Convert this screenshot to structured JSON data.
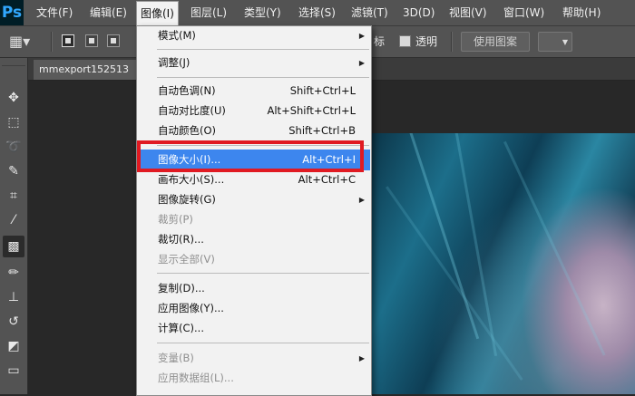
{
  "app": {
    "logo": "Ps"
  },
  "menubar": {
    "items": [
      "文件(F)",
      "编辑(E)",
      "图像(I)",
      "图层(L)",
      "类型(Y)",
      "选择(S)",
      "滤镜(T)",
      "3D(D)",
      "视图(V)",
      "窗口(W)",
      "帮助(H)"
    ],
    "active_index": 2
  },
  "options_bar": {
    "label_partial": "标",
    "transparent_label": "透明",
    "use_pattern_button": "使用图案"
  },
  "document": {
    "tab_title": "mmexport152513"
  },
  "image_menu": {
    "items": [
      {
        "label": "模式(M)",
        "shortcut": "",
        "submenu": true,
        "disabled": false
      },
      {
        "label": "调整(J)",
        "shortcut": "",
        "submenu": true,
        "disabled": false
      },
      {
        "label": "自动色调(N)",
        "shortcut": "Shift+Ctrl+L",
        "submenu": false,
        "disabled": false
      },
      {
        "label": "自动对比度(U)",
        "shortcut": "Alt+Shift+Ctrl+L",
        "submenu": false,
        "disabled": false
      },
      {
        "label": "自动颜色(O)",
        "shortcut": "Shift+Ctrl+B",
        "submenu": false,
        "disabled": false
      },
      {
        "label": "图像大小(I)...",
        "shortcut": "Alt+Ctrl+I",
        "submenu": false,
        "disabled": false,
        "highlighted": true
      },
      {
        "label": "画布大小(S)...",
        "shortcut": "Alt+Ctrl+C",
        "submenu": false,
        "disabled": false
      },
      {
        "label": "图像旋转(G)",
        "shortcut": "",
        "submenu": true,
        "disabled": false
      },
      {
        "label": "裁剪(P)",
        "shortcut": "",
        "submenu": false,
        "disabled": true
      },
      {
        "label": "裁切(R)...",
        "shortcut": "",
        "submenu": false,
        "disabled": false
      },
      {
        "label": "显示全部(V)",
        "shortcut": "",
        "submenu": false,
        "disabled": true
      },
      {
        "label": "复制(D)...",
        "shortcut": "",
        "submenu": false,
        "disabled": false
      },
      {
        "label": "应用图像(Y)...",
        "shortcut": "",
        "submenu": false,
        "disabled": false
      },
      {
        "label": "计算(C)...",
        "shortcut": "",
        "submenu": false,
        "disabled": false
      },
      {
        "label": "变量(B)",
        "shortcut": "",
        "submenu": true,
        "disabled": true
      },
      {
        "label": "应用数据组(L)...",
        "shortcut": "",
        "submenu": false,
        "disabled": true
      }
    ]
  },
  "icons": {
    "move": "move-icon",
    "marquee": "rect-marquee-icon",
    "lasso": "lasso-icon",
    "quick_select": "quick-select-icon",
    "crop": "crop-icon",
    "eyedropper": "eyedropper-icon",
    "pattern": "pattern-stamp-icon",
    "brush": "brush-icon",
    "stamp": "clone-stamp-icon",
    "history_brush": "history-brush-icon",
    "eraser": "eraser-icon",
    "gradient": "gradient-icon"
  },
  "colors": {
    "highlight": "#3d86ee",
    "annotation": "#e01a22",
    "ps_blue": "#31a8ff"
  }
}
